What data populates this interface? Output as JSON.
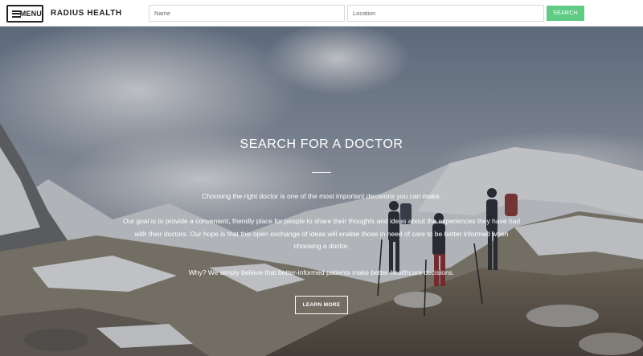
{
  "header": {
    "menu_label": "MENU",
    "brand": "RADIUS HEALTH",
    "name_placeholder": "Name",
    "location_placeholder": "Location",
    "search_label": "SEARCH"
  },
  "hero": {
    "title": "SEARCH FOR A DOCTOR",
    "paragraphs": [
      "Choosing the right doctor is one of the most important decisions you can make.",
      "Our goal is to provide a convenient, friendly place for people to share their thoughts and ideas about the experiences they have had with their doctors. Our hope is that this open exchange of ideas will enable those in need of care to be better informed when choosing a doctor.",
      "Why? We simply believe that better-informed patients make better healthcare decisions."
    ],
    "cta_label": "LEARN MORE"
  },
  "colors": {
    "accent_green": "#5fcb84",
    "header_bg": "#ffffff",
    "hero_text": "#ffffff"
  },
  "icons": {
    "menu": "hamburger-icon"
  }
}
